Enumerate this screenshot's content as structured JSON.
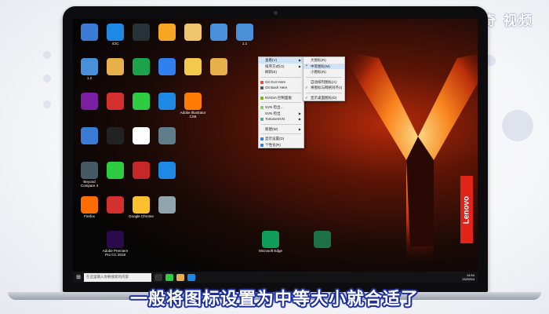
{
  "brand": "天奇 视频",
  "subtitle": "一般将图标设置为中等大小就合适了",
  "lenovo": "Lenovo",
  "colors": {
    "menu_highlight": "#cfe3f7",
    "taskbar": "#141416",
    "lenovo_red": "#e2231a",
    "subtitle_outline": "#1c2fa0"
  },
  "desktop_icons": [
    {
      "label": "",
      "icon": "network-icon",
      "color": "#3a7bd5"
    },
    {
      "label": "ICIC",
      "icon": "bird-icon",
      "color": "#1e88e5"
    },
    {
      "label": "",
      "icon": "camera-icon",
      "color": "#263238"
    },
    {
      "label": "",
      "icon": "star-icon",
      "color": "#f5a623"
    },
    {
      "label": "",
      "icon": "file-icon",
      "color": "#f0c36d"
    },
    {
      "label": "",
      "icon": "pc-icon",
      "color": "#4a90d9"
    },
    {
      "label": "1.1",
      "icon": "pc-icon",
      "color": "#4a90d9"
    },
    {
      "label": "1.2",
      "icon": "pc-icon",
      "color": "#4a90d9"
    },
    {
      "label": "",
      "icon": "folder-icon",
      "color": "#e8b04a"
    },
    {
      "label": "",
      "icon": "browser-icon",
      "color": "#1aa34a"
    },
    {
      "label": "",
      "icon": "cloud-icon",
      "color": "#2f80ed"
    },
    {
      "label": "",
      "icon": "archive-icon",
      "color": "#f2c94c"
    },
    {
      "label": "",
      "icon": "folder-icon",
      "color": "#e8b04a"
    },
    {
      "label": "",
      "icon": "app-icon",
      "color": "#7b1fa2"
    },
    {
      "label": "",
      "icon": "stop-icon",
      "color": "#d32f2f"
    },
    {
      "label": "",
      "icon": "forward-icon",
      "color": "#2ecc40"
    },
    {
      "label": "",
      "icon": "k-icon",
      "color": "#1e88e5"
    },
    {
      "label": "Adobe Illustrator CS6",
      "icon": "ai-icon",
      "color": "#ff7c00"
    },
    {
      "label": "",
      "icon": "search-icon",
      "color": "#3a7bd5"
    },
    {
      "label": "",
      "icon": "penguin-icon",
      "color": "#222"
    },
    {
      "label": "",
      "icon": "doc-icon",
      "color": "#fff"
    },
    {
      "label": "",
      "icon": "gear-icon",
      "color": "#607d8b"
    },
    {
      "label": "Beyond Compare 4",
      "icon": "compare-icon",
      "color": "#455a64"
    },
    {
      "label": "",
      "icon": "chat-icon",
      "color": "#2ecc40"
    },
    {
      "label": "",
      "icon": "video-icon",
      "color": "#c62828"
    },
    {
      "label": "",
      "icon": "plane-icon",
      "color": "#1e88e5"
    },
    {
      "label": "Firefox",
      "icon": "firefox-icon",
      "color": "#ff6d00"
    },
    {
      "label": "",
      "icon": "music-icon",
      "color": "#d32f2f"
    },
    {
      "label": "Google Chrome",
      "icon": "chrome-icon",
      "color": "#fbc02d"
    },
    {
      "label": "",
      "icon": "recycle-bin-icon",
      "color": "#90a4ae"
    },
    {
      "label": "Adobe Premiere Pro CC 2018",
      "icon": "pr-icon",
      "color": "#2a0a4a"
    },
    {
      "label": "Microsoft Edge",
      "icon": "edge-icon",
      "color": "#0f9d58"
    },
    {
      "label": "",
      "icon": "excel-icon",
      "color": "#1e7145"
    }
  ],
  "context_menu": {
    "items": [
      {
        "label": "查看(V)",
        "arrow": true,
        "hl": true
      },
      {
        "label": "排序方式(O)",
        "arrow": true
      },
      {
        "label": "刷新(E)",
        "arrow": false
      },
      {
        "sep": true
      },
      {
        "label": "Git GUI Here",
        "arrow": false,
        "icon": "#e94e2b"
      },
      {
        "label": "Git Bash Here",
        "arrow": false,
        "icon": "#555"
      },
      {
        "sep": true
      },
      {
        "label": "NVIDIA 控制面板",
        "arrow": false,
        "icon": "#76b900"
      },
      {
        "sep": true
      },
      {
        "label": "SVN 检出...",
        "arrow": false,
        "icon": "#8c6"
      },
      {
        "label": "SVN 检出",
        "arrow": true
      },
      {
        "label": "TortoiseSVN",
        "arrow": true,
        "icon": "#5aa"
      },
      {
        "sep": true
      },
      {
        "label": "新建(W)",
        "arrow": true
      },
      {
        "sep": true
      },
      {
        "label": "显示设置(D)",
        "arrow": false,
        "icon": "#2f80ed"
      },
      {
        "label": "个性化(R)",
        "arrow": false,
        "icon": "#2f80ed"
      }
    ]
  },
  "submenu": {
    "items": [
      {
        "label": "大图标(R)",
        "mark": "none"
      },
      {
        "label": "中等图标(M)",
        "mark": "dot",
        "hl": true
      },
      {
        "label": "小图标(N)",
        "mark": "none"
      },
      {
        "sep": true
      },
      {
        "label": "自动排列图标(A)",
        "mark": "none"
      },
      {
        "label": "将图标与网格对齐(I)",
        "mark": "chk"
      },
      {
        "sep": true
      },
      {
        "label": "显示桌面图标(D)",
        "mark": "chk"
      }
    ]
  },
  "taskbar": {
    "search_placeholder": "在这里输入你要搜索的内容",
    "time": "14:54",
    "date": "2020/9/4"
  }
}
